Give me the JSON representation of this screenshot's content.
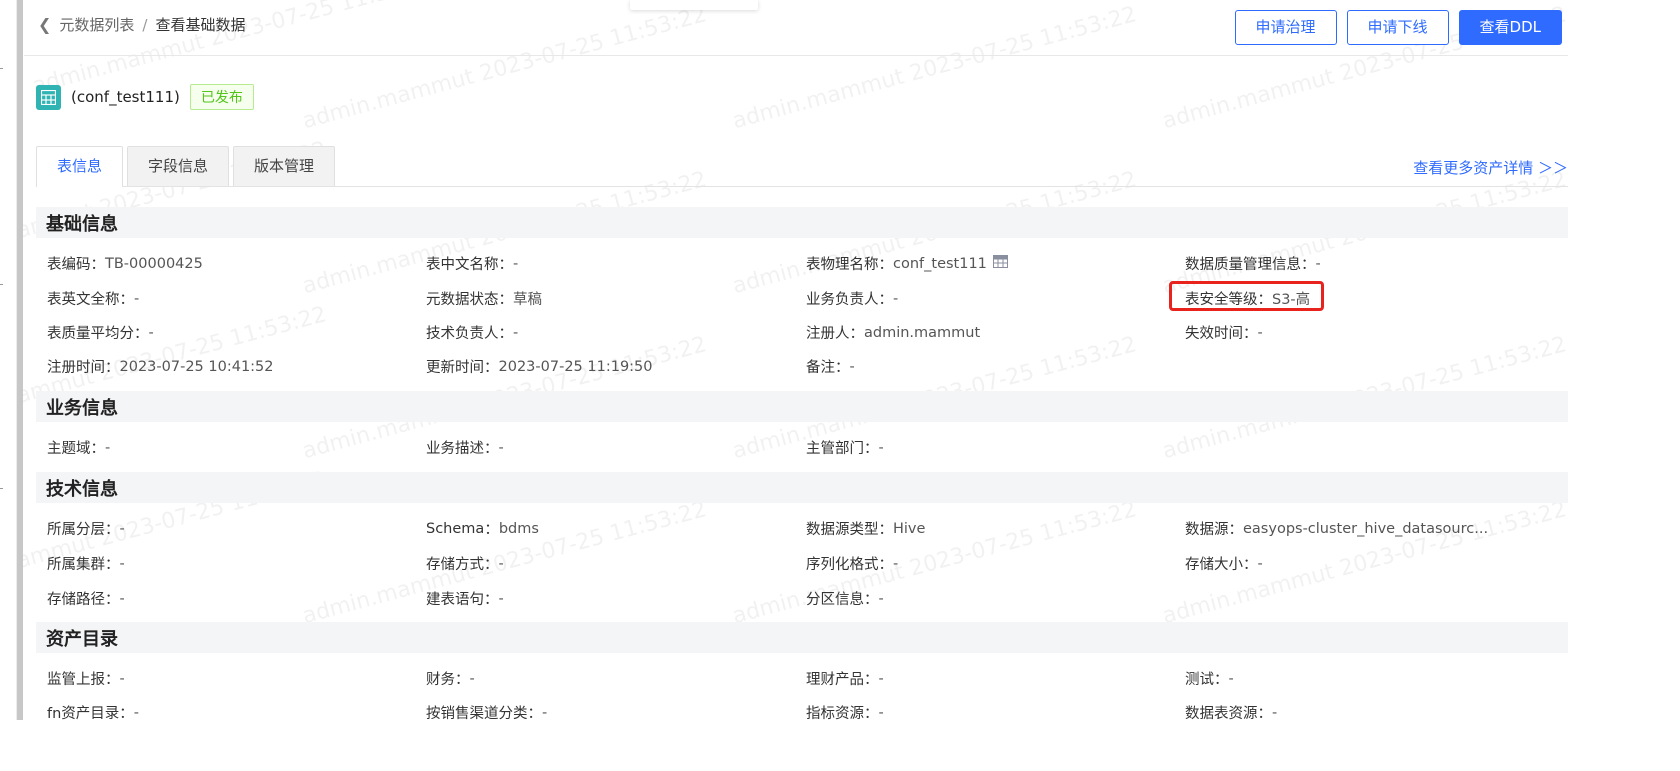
{
  "breadcrumb": {
    "back": "元数据列表",
    "separator": "/",
    "current": "查看基础数据"
  },
  "actions": {
    "apply_governance": "申请治理",
    "apply_offline": "申请下线",
    "view_ddl": "查看DDL"
  },
  "title": {
    "name": "(conf_test111)",
    "status": "已发布"
  },
  "tabs": [
    "表信息",
    "字段信息",
    "版本管理"
  ],
  "more_link": "查看更多资产详情 ＞＞",
  "sections": {
    "basic": {
      "title": "基础信息",
      "fields": [
        {
          "label": "表编码",
          "value": "TB-00000425"
        },
        {
          "label": "表中文名称",
          "value": "-"
        },
        {
          "label": "表物理名称",
          "value": "conf_test111"
        },
        {
          "label": "数据质量管理信息",
          "value": "-"
        },
        {
          "label": "表英文全称",
          "value": "-"
        },
        {
          "label": "元数据状态",
          "value": "草稿"
        },
        {
          "label": "业务负责人",
          "value": "-"
        },
        {
          "label": "表安全等级",
          "value": "S3-高"
        },
        {
          "label": "表质量平均分",
          "value": "-"
        },
        {
          "label": "技术负责人",
          "value": "-"
        },
        {
          "label": "注册人",
          "value": "admin.mammut"
        },
        {
          "label": "失效时间",
          "value": "-"
        },
        {
          "label": "注册时间",
          "value": "2023-07-25 10:41:52"
        },
        {
          "label": "更新时间",
          "value": "2023-07-25 11:19:50"
        },
        {
          "label": "备注",
          "value": "-"
        }
      ]
    },
    "business": {
      "title": "业务信息",
      "fields": [
        {
          "label": "主题域",
          "value": "-"
        },
        {
          "label": "业务描述",
          "value": "-"
        },
        {
          "label": "主管部门",
          "value": "-"
        }
      ]
    },
    "technical": {
      "title": "技术信息",
      "fields": [
        {
          "label": "所属分层",
          "value": "-"
        },
        {
          "label": "Schema",
          "value": "bdms"
        },
        {
          "label": "数据源类型",
          "value": "Hive"
        },
        {
          "label": "数据源",
          "value": "easyops-cluster_hive_datasourc..."
        },
        {
          "label": "所属集群",
          "value": "-"
        },
        {
          "label": "存储方式",
          "value": "-"
        },
        {
          "label": "序列化格式",
          "value": "-"
        },
        {
          "label": "存储大小",
          "value": "-"
        },
        {
          "label": "存储路径",
          "value": "-"
        },
        {
          "label": "建表语句",
          "value": "-"
        },
        {
          "label": "分区信息",
          "value": "-"
        }
      ]
    },
    "catalog": {
      "title": "资产目录",
      "fields": [
        {
          "label": "监管上报",
          "value": "-"
        },
        {
          "label": "财务",
          "value": "-"
        },
        {
          "label": "理财产品",
          "value": "-"
        },
        {
          "label": "测试",
          "value": "-"
        },
        {
          "label": "fn资产目录",
          "value": "-"
        },
        {
          "label": "按销售渠道分类",
          "value": "-"
        },
        {
          "label": "指标资源",
          "value": "-"
        },
        {
          "label": "数据表资源",
          "value": "-"
        }
      ]
    }
  },
  "label_suffix": "：",
  "watermark": "admin.mammut 2023-07-25 11:53:22",
  "colors": {
    "primary": "#2f6bff",
    "published_green": "#52c41a",
    "highlight_red": "#e8231e",
    "table_icon": "#2fb3b3",
    "section_bg": "#f4f5f7"
  },
  "icons": {
    "back": "chevron-left-icon",
    "table": "table-grid-icon",
    "physical_name": "table-grid-icon"
  }
}
